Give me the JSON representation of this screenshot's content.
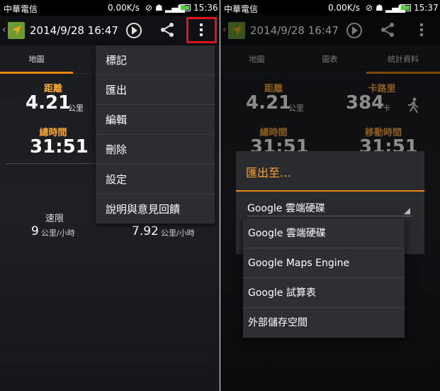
{
  "status_bar": {
    "carrier": "中華電信",
    "data_rate": "0.00K/s",
    "left_time": "15:36",
    "right_time": "15:37"
  },
  "action_bar": {
    "title": "2014/9/28 16:47"
  },
  "left": {
    "tabs": [
      "地圖"
    ],
    "stats": {
      "distance_label": "距離",
      "distance_value": "4.21",
      "distance_unit": "公里",
      "total_time_label": "總時間",
      "total_time_value": "31:51",
      "speed_label": "速限",
      "speed_value": "9",
      "speed_unit": "公里/小時",
      "pace_value": "7.92",
      "pace_unit": "公里/小時"
    },
    "menu": [
      "標記",
      "匯出",
      "編輯",
      "刪除",
      "設定",
      "說明與意見回饋"
    ]
  },
  "right": {
    "tabs": [
      "地圖",
      "圖表",
      "統計資料"
    ],
    "stats": {
      "distance_label": "距離",
      "distance_value": "4.21",
      "distance_unit": "公里",
      "calories_label": "卡路里",
      "calories_value": "384",
      "calories_unit": "卡",
      "total_time_label": "總時間",
      "total_time_value": "31:51",
      "moving_time_label": "移動時間",
      "moving_time_value": "31:51"
    },
    "dialog": {
      "title": "匯出至...",
      "selected": "Google 雲端硬碟",
      "options": [
        "Google 雲端硬碟",
        "Google Maps Engine",
        "Google 試算表",
        "外部儲存空間"
      ]
    }
  },
  "colors": {
    "accent": "#e88410",
    "label_orange": "#ffab2e",
    "highlight": "#e3131b",
    "logo_green": "#6a9c2f"
  },
  "icons": [
    "back-chevron-icon",
    "app-logo-icon",
    "play-icon",
    "share-icon",
    "overflow-menu-icon",
    "walking-icon",
    "signal-icon",
    "wifi-icon",
    "battery-icon"
  ]
}
